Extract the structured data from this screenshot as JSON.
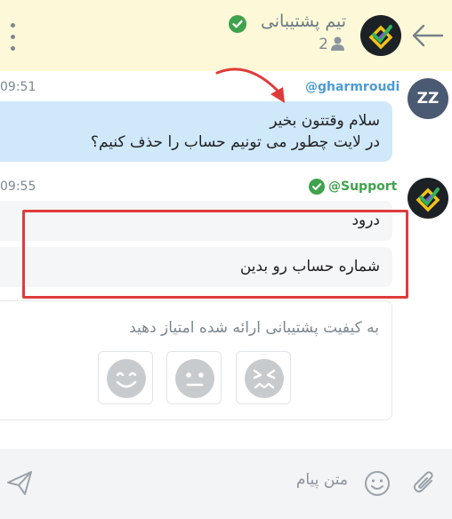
{
  "header": {
    "title": "تیم پشتیبانی",
    "member_count": "2",
    "icons": [
      "more-vert-icon",
      "verified-check-icon",
      "members-icon",
      "back-arrow-icon"
    ],
    "accent_color": "#3fa34d",
    "background_color": "#fdf9d8"
  },
  "messages": [
    {
      "sender": "@gharmroudi",
      "time": "09:51",
      "avatar_text": "ZZ",
      "lines": [
        "سلام وقتتون بخیر",
        "در لایت چطور می تونیم حساب را حذف کنیم؟"
      ],
      "bubble_color": "#cfe8fa"
    },
    {
      "sender": "@Support",
      "time": "09:55",
      "verified": true,
      "bubbles": [
        "درود",
        "شماره حساب رو بدین"
      ],
      "bubble_color": "#f5f6f7"
    }
  ],
  "rating": {
    "prompt": "به کیفیت پشتیبانی ارائه شده امتیاز دهید",
    "options": [
      "happy-face-icon",
      "neutral-face-icon",
      "sad-face-icon"
    ]
  },
  "annotations": {
    "highlight_color": "#e03b3b"
  },
  "input": {
    "placeholder": "متن پیام",
    "icons": [
      "send-icon",
      "emoji-icon",
      "attach-icon"
    ]
  }
}
